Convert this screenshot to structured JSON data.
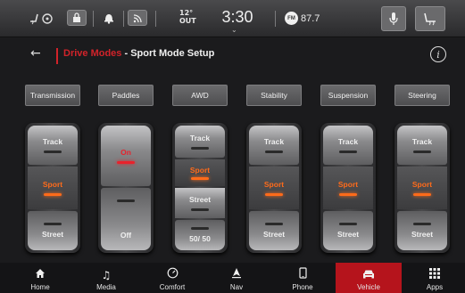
{
  "status_bar": {
    "temp_value": "12°",
    "temp_label": "OUT",
    "time": "3:30",
    "radio_band": "FM",
    "radio_freq": "87.7"
  },
  "header": {
    "title_main": "Drive Modes",
    "title_sub": " - Sport Mode Setup"
  },
  "tabs": [
    "Transmission",
    "Paddles",
    "AWD",
    "Stability",
    "Suspension",
    "Steering"
  ],
  "switches": {
    "transmission": {
      "top": "Track",
      "mid": "Sport",
      "bottom": "Street",
      "selected": "Sport"
    },
    "paddles": {
      "top": "On",
      "bottom": "Off",
      "selected": "On"
    },
    "awd": {
      "top": "Track",
      "mid_upper": "Sport",
      "mid_lower": "Street",
      "bottom": "50/ 50",
      "selected": "Sport"
    },
    "stability": {
      "top": "Track",
      "mid": "Sport",
      "bottom": "Street",
      "selected": "Sport"
    },
    "suspension": {
      "top": "Track",
      "mid": "Sport",
      "bottom": "Street",
      "selected": "Sport"
    },
    "steering": {
      "top": "Track",
      "mid": "Sport",
      "bottom": "Street",
      "selected": "Sport"
    }
  },
  "nav": {
    "items": [
      {
        "label": "Home",
        "icon": "home-icon"
      },
      {
        "label": "Media",
        "icon": "music-note-icon"
      },
      {
        "label": "Comfort",
        "icon": "gauge-icon"
      },
      {
        "label": "Nav",
        "icon": "navigation-arrow-icon"
      },
      {
        "label": "Phone",
        "icon": "phone-icon"
      },
      {
        "label": "Vehicle",
        "icon": "car-icon"
      },
      {
        "label": "Apps",
        "icon": "apps-grid-icon"
      }
    ],
    "active": "Vehicle"
  },
  "colors": {
    "accent_red": "#d2232a",
    "active_orange": "#ff6b1a",
    "nav_active": "#b5141c"
  }
}
